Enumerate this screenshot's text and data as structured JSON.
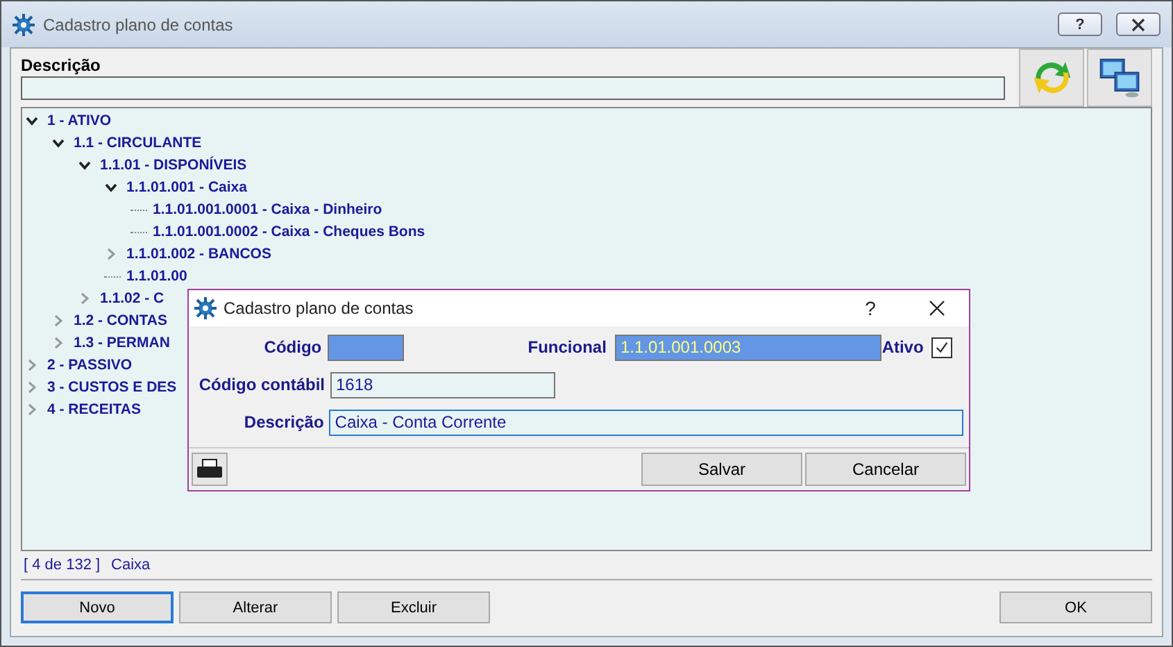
{
  "window": {
    "title": "Cadastro plano de contas",
    "help": "?"
  },
  "filter": {
    "label": "Descrição"
  },
  "tree": [
    {
      "label": "1 - ATIVO",
      "expanded": true,
      "children": [
        {
          "label": "1.1 - CIRCULANTE",
          "expanded": true,
          "children": [
            {
              "label": "1.1.01 - DISPONÍVEIS",
              "expanded": true,
              "children": [
                {
                  "label": "1.1.01.001 - Caixa",
                  "expanded": true,
                  "children": [
                    {
                      "label": "1.1.01.001.0001 - Caixa - Dinheiro"
                    },
                    {
                      "label": "1.1.01.001.0002 - Caixa - Cheques Bons"
                    }
                  ]
                },
                {
                  "label": "1.1.01.002 - BANCOS",
                  "expanded": false
                },
                {
                  "label": "1.1.01.00"
                }
              ]
            },
            {
              "label": "1.1.02 - C",
              "expanded": false
            }
          ]
        },
        {
          "label": "1.2 - CONTAS",
          "expanded": false
        },
        {
          "label": "1.3 - PERMAN",
          "expanded": false
        }
      ]
    },
    {
      "label": "2 - PASSIVO",
      "expanded": false
    },
    {
      "label": "3 - CUSTOS E DES",
      "expanded": false
    },
    {
      "label": "4 - RECEITAS",
      "expanded": false
    }
  ],
  "status": {
    "position": "[ 4 de 132 ]",
    "current": "Caixa"
  },
  "buttons": [
    {
      "label": "Novo",
      "focused": true
    },
    {
      "label": "Alterar",
      "focused": false
    },
    {
      "label": "Excluir",
      "focused": false
    }
  ],
  "ok_button": {
    "label": "OK"
  },
  "dialog": {
    "title": "Cadastro plano de contas",
    "help": "?",
    "codigo": {
      "label": "Código",
      "selected": true
    },
    "funcional": {
      "label": "Funcional",
      "value": "1.1.01.001.0003",
      "selected": true
    },
    "ativo": {
      "label": "Ativo",
      "checked": true
    },
    "codigo_contabil": {
      "label": "Código contábil",
      "value": "1618"
    },
    "descricao": {
      "label": "Descrição",
      "value": "Caixa - Conta Corrente",
      "focused": true
    },
    "buttons": [
      {
        "label": "Salvar"
      },
      {
        "label": "Cancelar"
      }
    ]
  }
}
